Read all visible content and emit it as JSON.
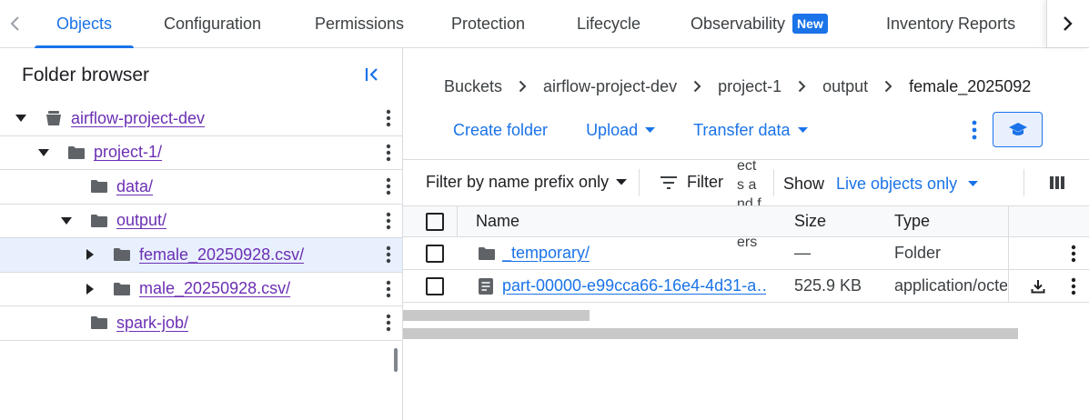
{
  "tabs": [
    {
      "label": "Objects",
      "active": true
    },
    {
      "label": "Configuration"
    },
    {
      "label": "Permissions"
    },
    {
      "label": "Protection"
    },
    {
      "label": "Lifecycle"
    },
    {
      "label": "Observability",
      "badge": "New"
    },
    {
      "label": "Inventory Reports"
    }
  ],
  "folder_browser": {
    "title": "Folder browser",
    "items": [
      {
        "label": "airflow-project-dev",
        "type": "bucket",
        "expanded": true
      },
      {
        "label": "project-1/",
        "type": "folder",
        "expanded": true
      },
      {
        "label": "data/",
        "type": "folder"
      },
      {
        "label": "output/",
        "type": "folder",
        "expanded": true
      },
      {
        "label": "female_20250928.csv/",
        "type": "folder",
        "expanded": false,
        "selected": true
      },
      {
        "label": "male_20250928.csv/",
        "type": "folder",
        "expanded": false
      },
      {
        "label": "spark-job/",
        "type": "folder"
      }
    ]
  },
  "breadcrumbs": [
    "Buckets",
    "airflow-project-dev",
    "project-1",
    "output",
    "female_2025092"
  ],
  "actions": {
    "create_folder": "Create folder",
    "upload": "Upload",
    "transfer_data": "Transfer data"
  },
  "filter": {
    "prefix_label": "Filter by name prefix only",
    "filter_label": "Filter",
    "wrapped_text": "ects and folders",
    "show_label": "Show",
    "show_value": "Live objects only"
  },
  "table": {
    "headers": {
      "name": "Name",
      "size": "Size",
      "type": "Type"
    },
    "rows": [
      {
        "name": "_temporary/",
        "size": "—",
        "type": "Folder",
        "icon": "folder-icon"
      },
      {
        "name": "part-00000-e99cca66-16e4-4d31-a…",
        "size": "525.9 KB",
        "type": "application/octe",
        "icon": "file-icon"
      }
    ]
  },
  "colors": {
    "accent": "#1a73e8",
    "visited_link": "#6b2fb3",
    "selected_row": "#e8f0fe",
    "border": "#dadce0"
  }
}
